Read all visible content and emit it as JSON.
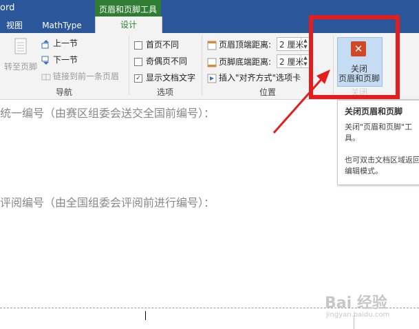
{
  "titlebar": {
    "app_title_fragment": "ord",
    "context_tab_label": "页眉和页脚工具"
  },
  "tabs": {
    "view": "视图",
    "mathtype": "MathType",
    "design": "设计"
  },
  "nav_group": {
    "goto_footer": "转至页脚",
    "prev_section": "上一节",
    "next_section": "下一节",
    "link_prev": "链接到前一条页眉",
    "label": "导航"
  },
  "options_group": {
    "first_page_diff": "首页不同",
    "odd_even_diff": "奇偶页不同",
    "show_doc_text": "显示文档文字",
    "label": "选项"
  },
  "position_group": {
    "header_top_label": "页眉顶端距离:",
    "header_top_value": "2 厘米",
    "footer_bottom_label": "页脚底端距离:",
    "footer_bottom_value": "2 厘米",
    "insert_align_tab": "插入\"对齐方式\"选项卡",
    "label": "位置"
  },
  "close_group": {
    "button_line1": "关闭",
    "button_line2": "页眉和页脚",
    "label": "关闭"
  },
  "tooltip": {
    "title": "关闭页眉和页脚",
    "body1": "关闭\"页眉和页脚\"工具。",
    "body2": "也可双击文档区域返回编辑模式。"
  },
  "document": {
    "line1": "统一编号（由赛区组委会送交全国前编号）：",
    "line2": "评阅编号（由全国组委会评阅前进行编号）："
  },
  "watermark": {
    "text": "Bai 经验",
    "sub": "jingyan.baidu.com"
  },
  "colors": {
    "title_blue": "#2b579a",
    "context_green": "#2f7d32",
    "highlight_red": "#e51c1c",
    "close_icon": "#d24726"
  }
}
